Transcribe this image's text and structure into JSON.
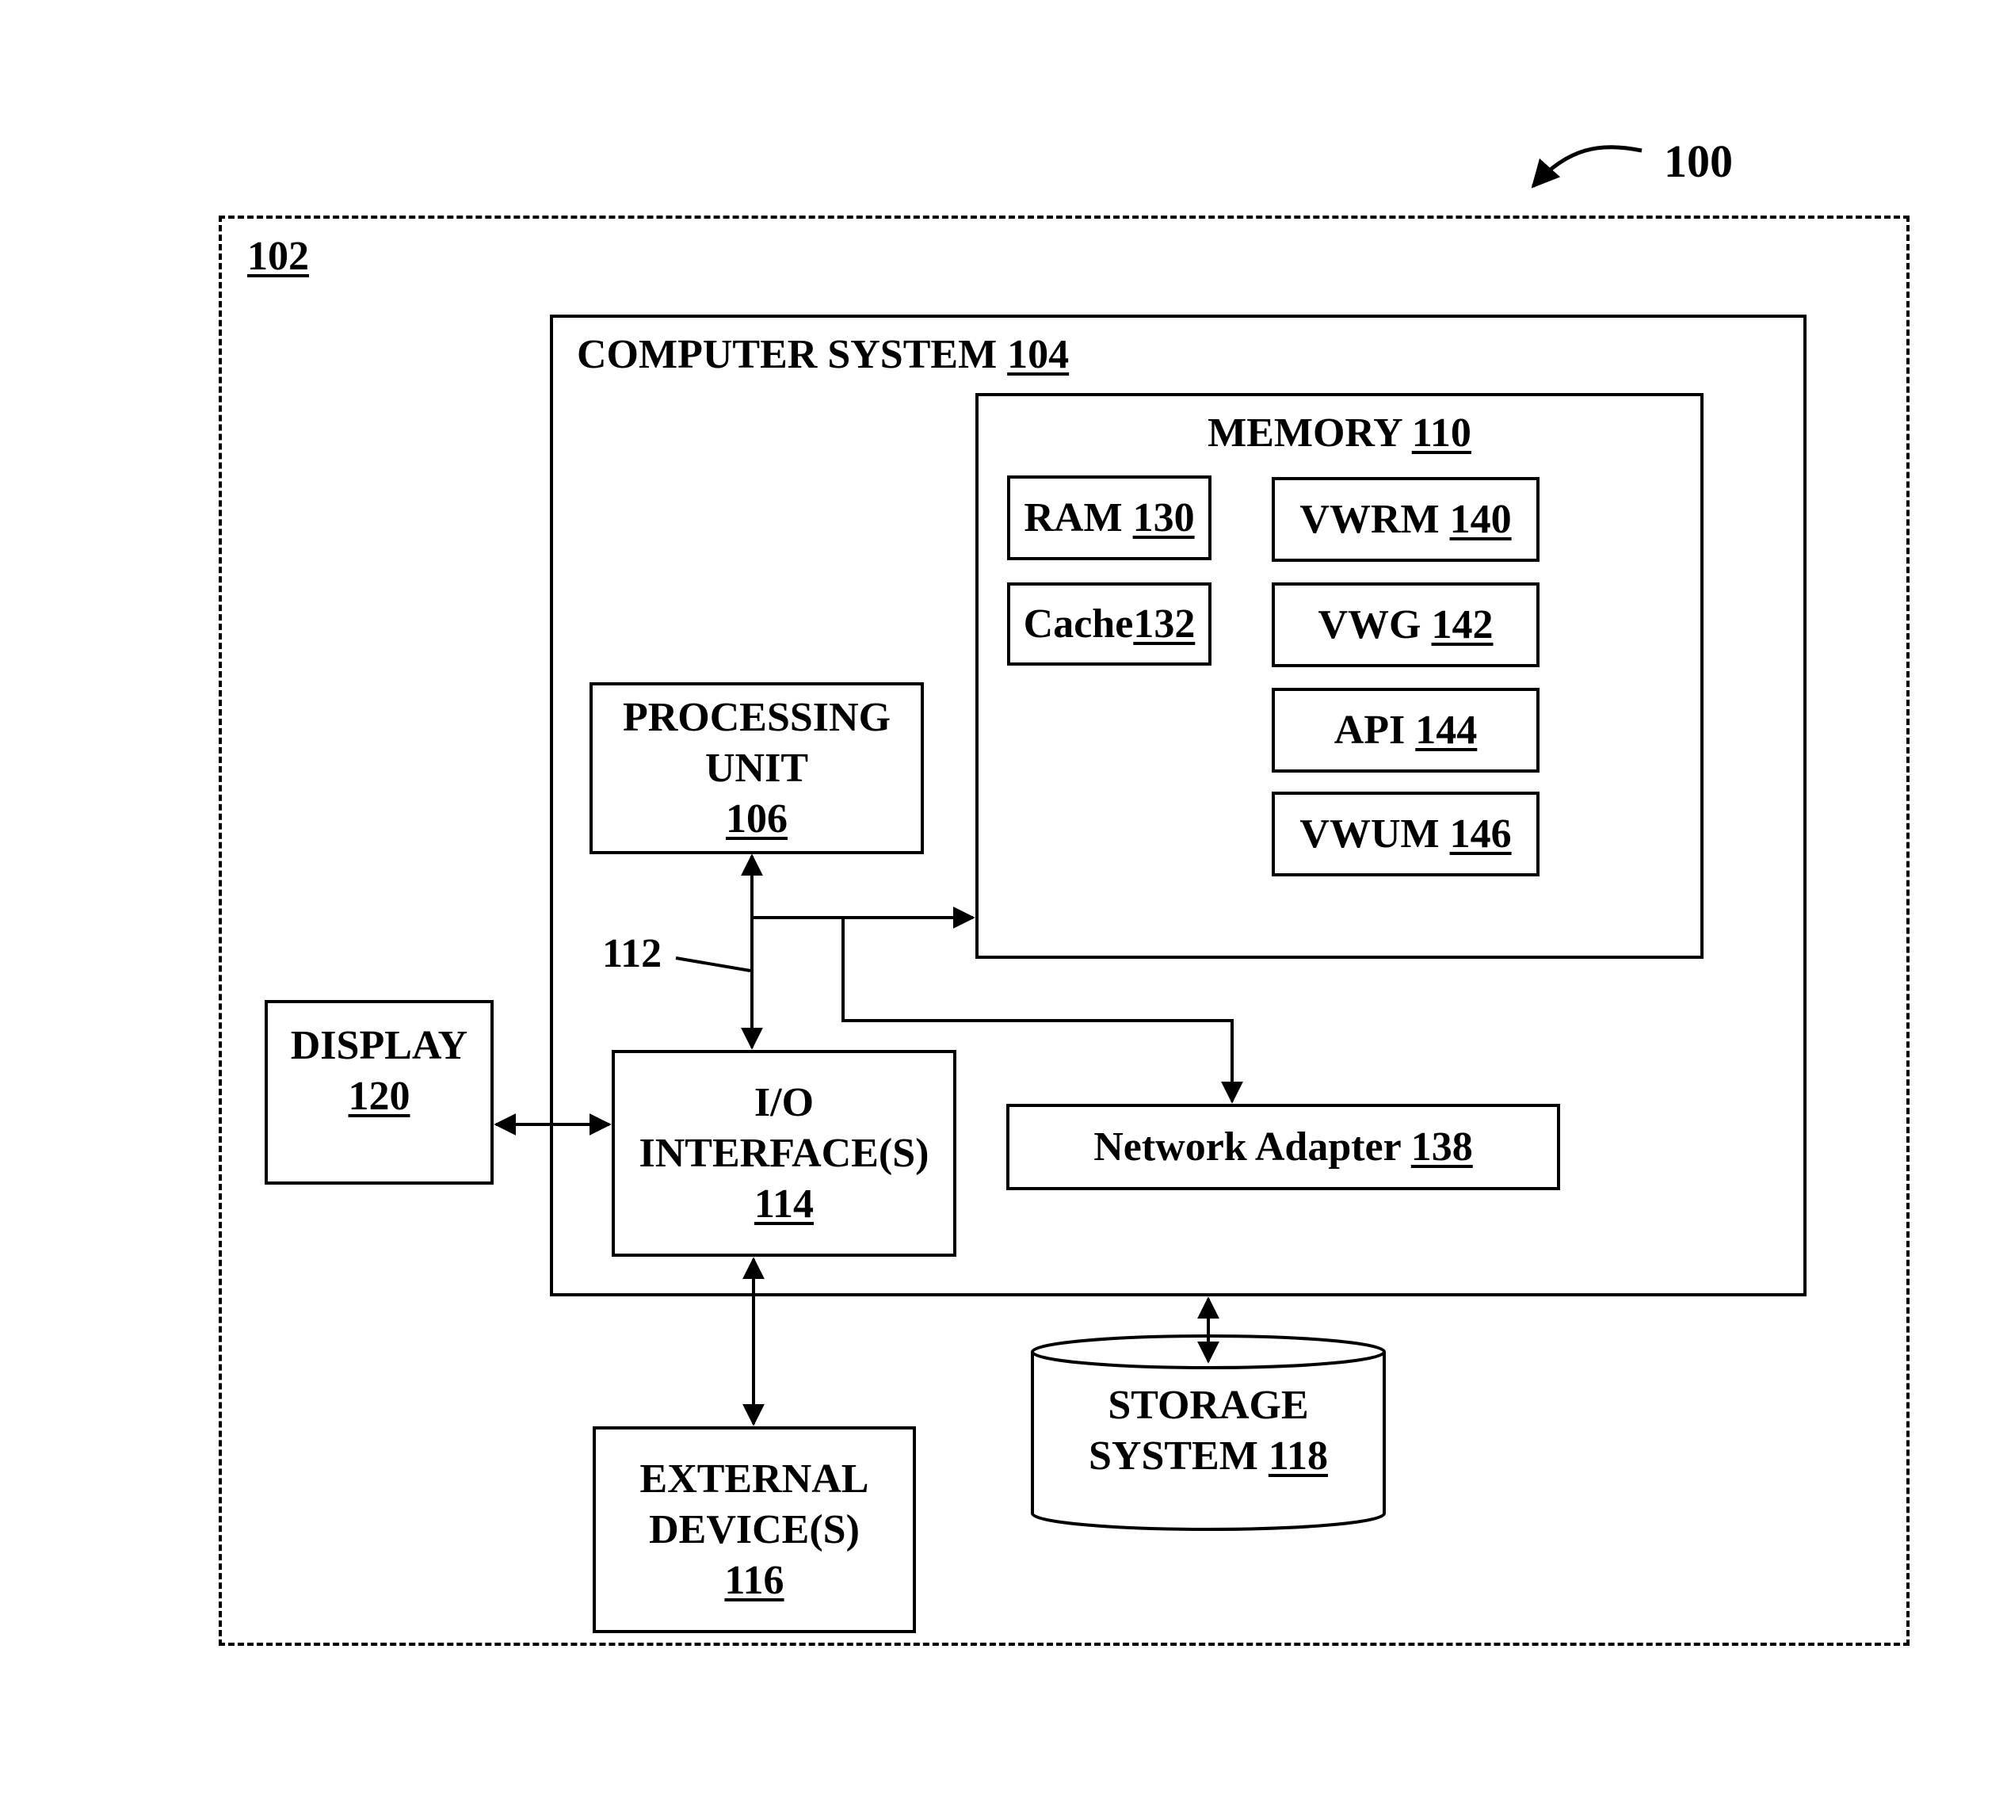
{
  "figure_ref": "100",
  "environment": {
    "ref": "102"
  },
  "computer_system": {
    "label": "COMPUTER SYSTEM",
    "ref": "104"
  },
  "memory": {
    "label": "MEMORY",
    "ref": "110",
    "items": [
      {
        "label": "RAM",
        "ref": "130"
      },
      {
        "label": "Cache",
        "ref": "132"
      },
      {
        "label": "VWRM",
        "ref": "140"
      },
      {
        "label": "VWG",
        "ref": "142"
      },
      {
        "label": "API",
        "ref": "144"
      },
      {
        "label": "VWUM",
        "ref": "146"
      }
    ]
  },
  "processing_unit": {
    "line1": "PROCESSING",
    "line2": "UNIT",
    "ref": "106"
  },
  "bus": {
    "ref": "112"
  },
  "io_interface": {
    "line1": "I/O",
    "line2": "INTERFACE(S)",
    "ref": "114"
  },
  "display": {
    "label": "DISPLAY",
    "ref": "120"
  },
  "network_adapter": {
    "label": "Network Adapter",
    "ref": "138"
  },
  "external_devices": {
    "line1": "EXTERNAL",
    "line2": "DEVICE(S)",
    "ref": "116"
  },
  "storage_system": {
    "line1": "STORAGE",
    "line2": "SYSTEM",
    "ref": "118"
  }
}
